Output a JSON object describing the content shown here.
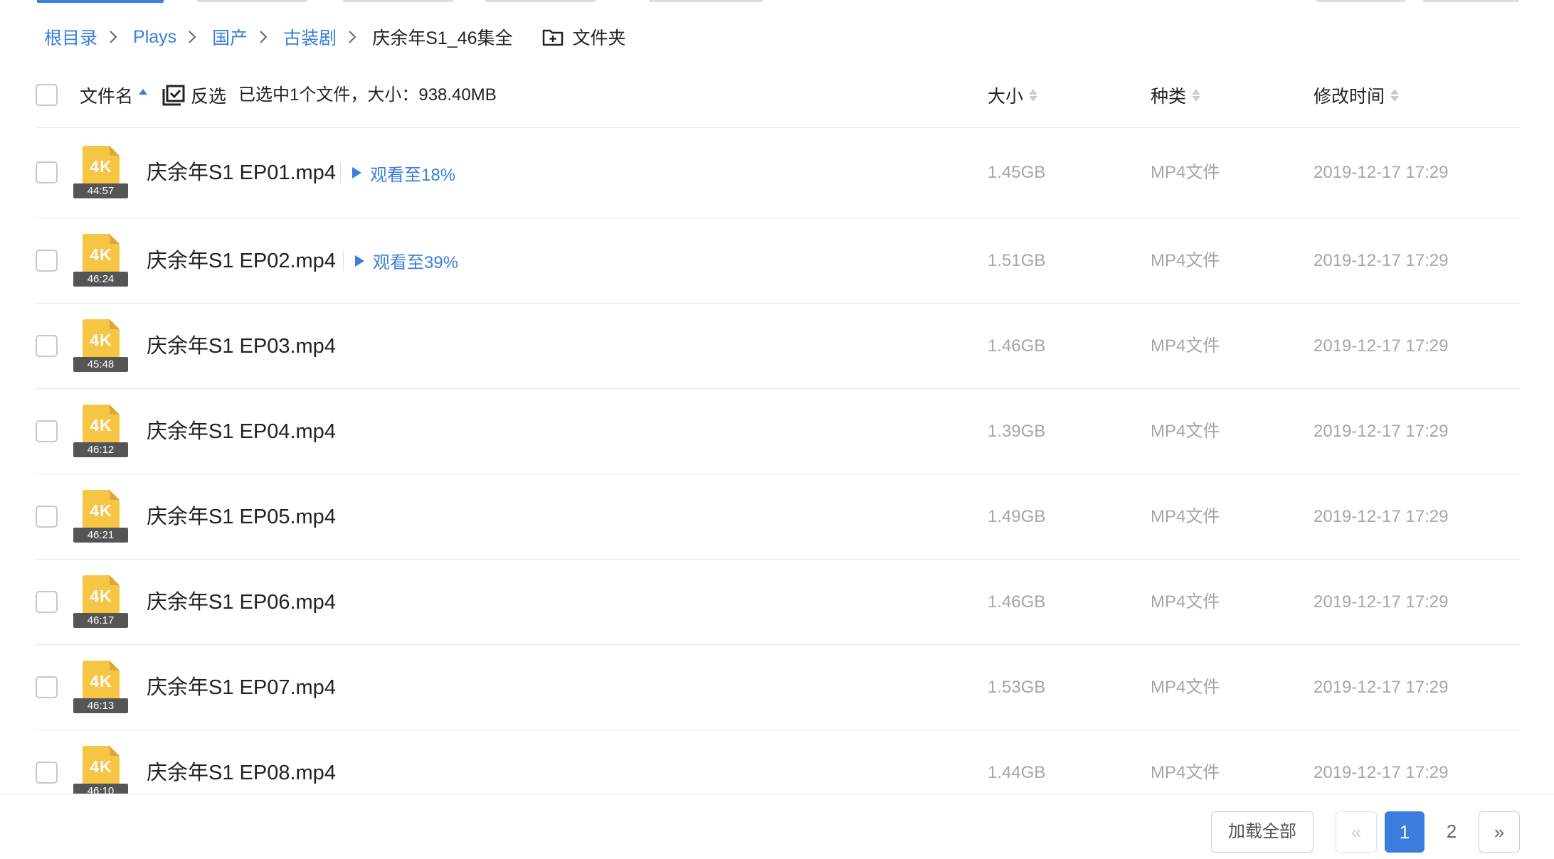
{
  "breadcrumb": {
    "items": [
      "根目录",
      "Plays",
      "国产",
      "古装剧"
    ],
    "current": "庆余年S1_46集全",
    "folder_button_label": "文件夹"
  },
  "header": {
    "name_label": "文件名",
    "invert_label": "反选",
    "selected_info": "已选中1个文件，大小：938.40MB",
    "size_label": "大小",
    "type_label": "种类",
    "time_label": "修改时间"
  },
  "files": [
    {
      "quality": "4K",
      "duration": "44:57",
      "name": "庆余年S1 EP01.mp4",
      "progress": "观看至18%",
      "size": "1.45GB",
      "type": "MP4文件",
      "modified": "2019-12-17 17:29"
    },
    {
      "quality": "4K",
      "duration": "46:24",
      "name": "庆余年S1 EP02.mp4",
      "progress": "观看至39%",
      "size": "1.51GB",
      "type": "MP4文件",
      "modified": "2019-12-17 17:29"
    },
    {
      "quality": "4K",
      "duration": "45:48",
      "name": "庆余年S1 EP03.mp4",
      "progress": "",
      "size": "1.46GB",
      "type": "MP4文件",
      "modified": "2019-12-17 17:29"
    },
    {
      "quality": "4K",
      "duration": "46:12",
      "name": "庆余年S1 EP04.mp4",
      "progress": "",
      "size": "1.39GB",
      "type": "MP4文件",
      "modified": "2019-12-17 17:29"
    },
    {
      "quality": "4K",
      "duration": "46:21",
      "name": "庆余年S1 EP05.mp4",
      "progress": "",
      "size": "1.49GB",
      "type": "MP4文件",
      "modified": "2019-12-17 17:29"
    },
    {
      "quality": "4K",
      "duration": "46:17",
      "name": "庆余年S1 EP06.mp4",
      "progress": "",
      "size": "1.46GB",
      "type": "MP4文件",
      "modified": "2019-12-17 17:29"
    },
    {
      "quality": "4K",
      "duration": "46:13",
      "name": "庆余年S1 EP07.mp4",
      "progress": "",
      "size": "1.53GB",
      "type": "MP4文件",
      "modified": "2019-12-17 17:29"
    },
    {
      "quality": "4K",
      "duration": "46:10",
      "name": "庆余年S1 EP08.mp4",
      "progress": "",
      "size": "1.44GB",
      "type": "MP4文件",
      "modified": "2019-12-17 17:29"
    }
  ],
  "footer": {
    "load_all_label": "加载全部",
    "prev_label": "«",
    "pages": [
      "1",
      "2"
    ],
    "current_page": "1",
    "next_label": "»"
  },
  "colors": {
    "accent": "#3b7ddd",
    "file_icon": "#f5c543",
    "muted_text": "#a6a6a6"
  }
}
